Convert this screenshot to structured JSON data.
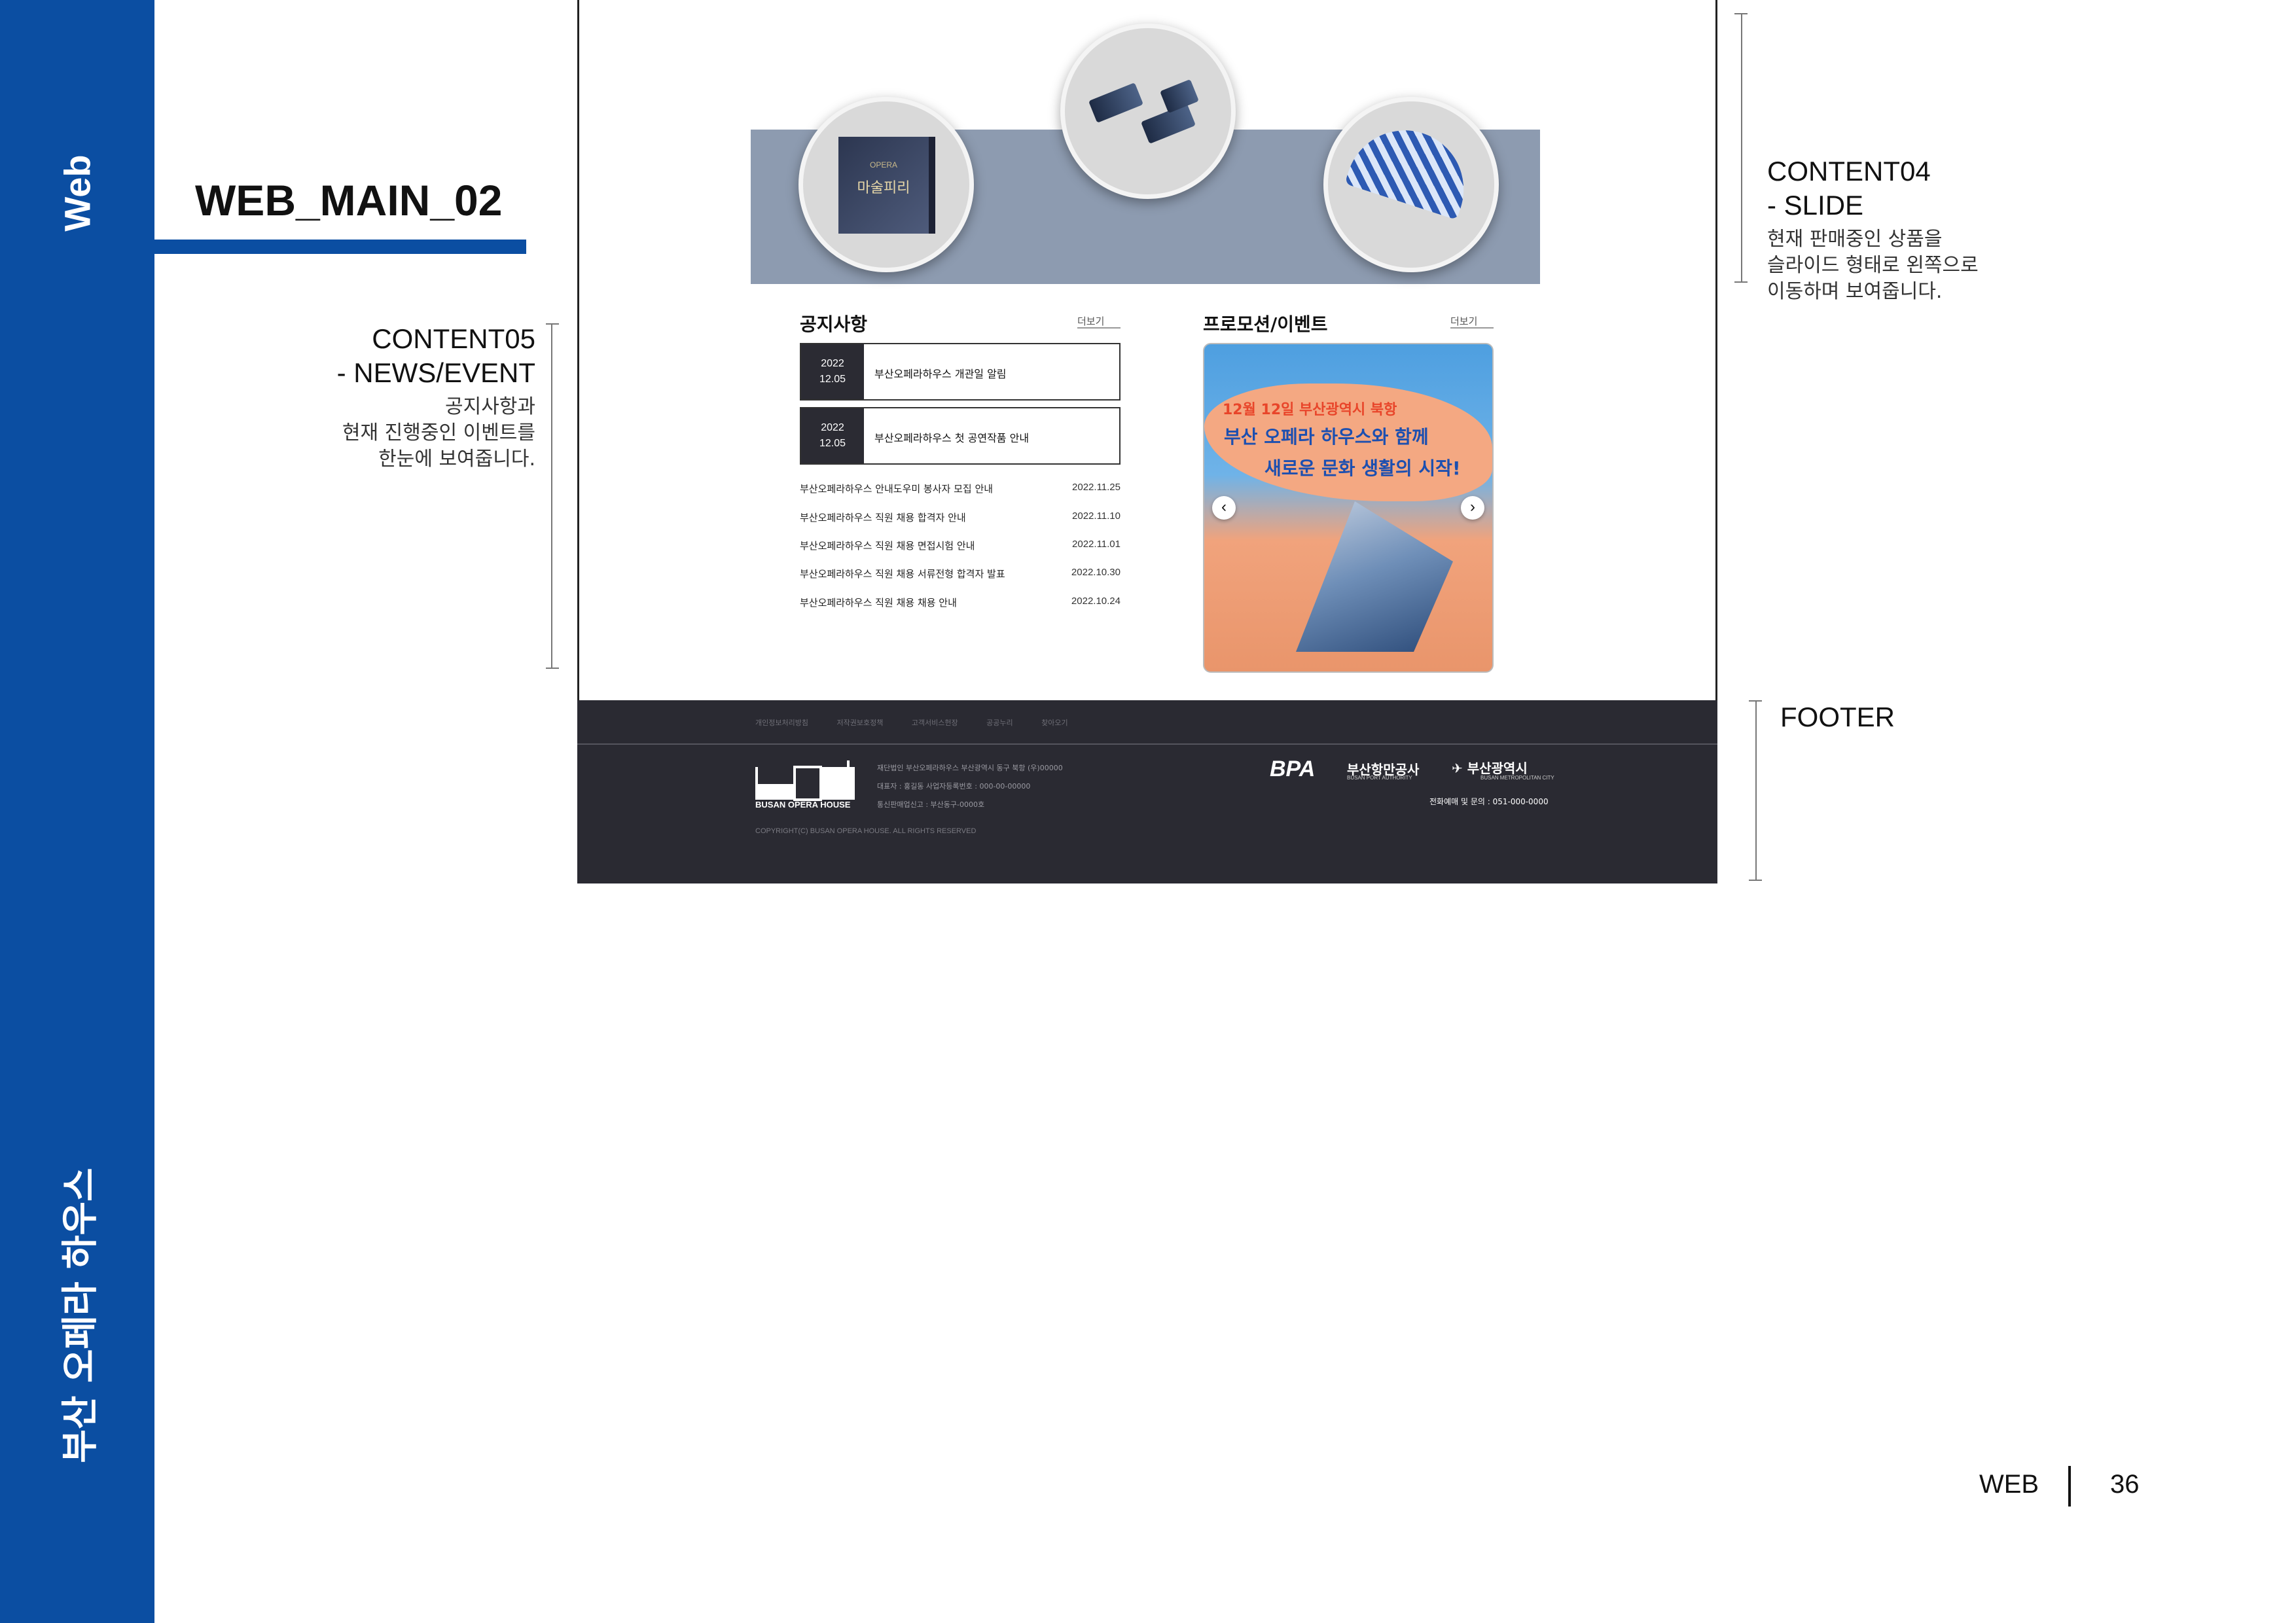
{
  "sidebar": {
    "section": "Web",
    "project": "부산 오페라 하우스"
  },
  "page_title": "WEB_MAIN_02",
  "annotations": {
    "content05": {
      "title1": "CONTENT05",
      "title2": "- NEWS/EVENT",
      "desc1": "공지사항과",
      "desc2": "현재 진행중인 이벤트를",
      "desc3": "한눈에 보여줍니다."
    },
    "content04": {
      "title1": "CONTENT04",
      "title2": "- SLIDE",
      "desc1": "현재 판매중인 상품을",
      "desc2": "슬라이드 형태로 왼쪽으로",
      "desc3": "이동하며 보여줍니다."
    },
    "footer": {
      "title": "FOOTER"
    }
  },
  "products": {
    "album_title": "마술피리",
    "album_label": "OPERA"
  },
  "notice": {
    "title": "공지사항",
    "more": "더보기",
    "featured": [
      {
        "year": "2022",
        "date": "12.05",
        "text": "부산오페라하우스 개관일 알림"
      },
      {
        "year": "2022",
        "date": "12.05",
        "text": "부산오페라하우스 첫 공연작품 안내"
      }
    ],
    "list": [
      {
        "text": "부산오페라하우스 안내도우미 봉사자 모집 안내",
        "date": "2022.11.25"
      },
      {
        "text": "부산오페라하우스 직원 채용 합격자 안내",
        "date": "2022.11.10"
      },
      {
        "text": "부산오페라하우스 직원 채용 면접시험 안내",
        "date": "2022.11.01"
      },
      {
        "text": "부산오페라하우스 직원 채용 서류전형 합격자 발표",
        "date": "2022.10.30"
      },
      {
        "text": "부산오페라하우스 직원 채용 채용 안내",
        "date": "2022.10.24"
      }
    ]
  },
  "promo": {
    "title": "프로모션/이벤트",
    "more": "더보기",
    "line1": "12월 12일  부산광역시 북항",
    "line2": "부산 오페라 하우스와 함께",
    "line3": "새로운 문화 생활의 시작!",
    "prev": "‹",
    "next": "›"
  },
  "footer": {
    "links": [
      "개인정보처리방침",
      "저작권보호정책",
      "고객서비스헌장",
      "공공누리",
      "찾아오기"
    ],
    "logo_text": "BUSAN OPERA HOUSE",
    "info1": "재단법인 부산오페라하우스 부산광역시 동구 북항 (우)00000",
    "info2": "대표자 : 홍길동 사업자등록번호 : 000-00-00000",
    "info3": "통신판매업신고 : 부산동구-0000호",
    "copyright": "COPYRIGHT(C) BUSAN OPERA HOUSE. ALL RIGHTS RESERVED",
    "bpa": "BPA",
    "bpa_kr": "부산항만공사",
    "bpa_en": "BUSAN PORT AUTHORITY",
    "busan_kr": "부산광역시",
    "busan_en": "BUSAN METROPOLITAN CITY",
    "phone": "전화예매 및 문의 : 051-000-0000"
  },
  "pager": {
    "label": "WEB",
    "page": "36"
  },
  "colors": {
    "brand_blue": "#0b4ea2",
    "footer_bg": "#2a2a32",
    "banner": "#8d9bb0"
  }
}
